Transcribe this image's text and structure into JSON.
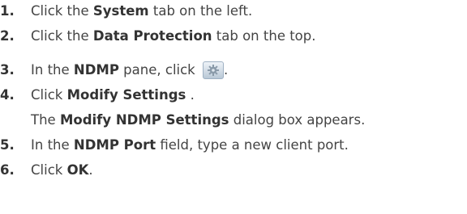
{
  "steps": [
    {
      "number": "1.",
      "prefix": "Click the ",
      "bold": "System",
      "suffix": " tab on the left."
    },
    {
      "number": "2.",
      "prefix": "Click the ",
      "bold": "Data Protection",
      "suffix": " tab on the top."
    },
    {
      "number": "3.",
      "prefix": "In the ",
      "bold": "NDMP",
      "suffix": " pane, click ",
      "icon": "gear-icon",
      "after_icon": "."
    },
    {
      "number": "4.",
      "prefix": "Click ",
      "bold": "Modify Settings",
      "suffix": " .",
      "result": {
        "prefix": "The ",
        "bold": "Modify NDMP Settings",
        "suffix": " dialog box appears."
      }
    },
    {
      "number": "5.",
      "prefix": "In the ",
      "bold": "NDMP Port",
      "suffix": " field, type a new client port."
    },
    {
      "number": "6.",
      "prefix": "Click ",
      "bold": "OK",
      "suffix": "."
    }
  ]
}
